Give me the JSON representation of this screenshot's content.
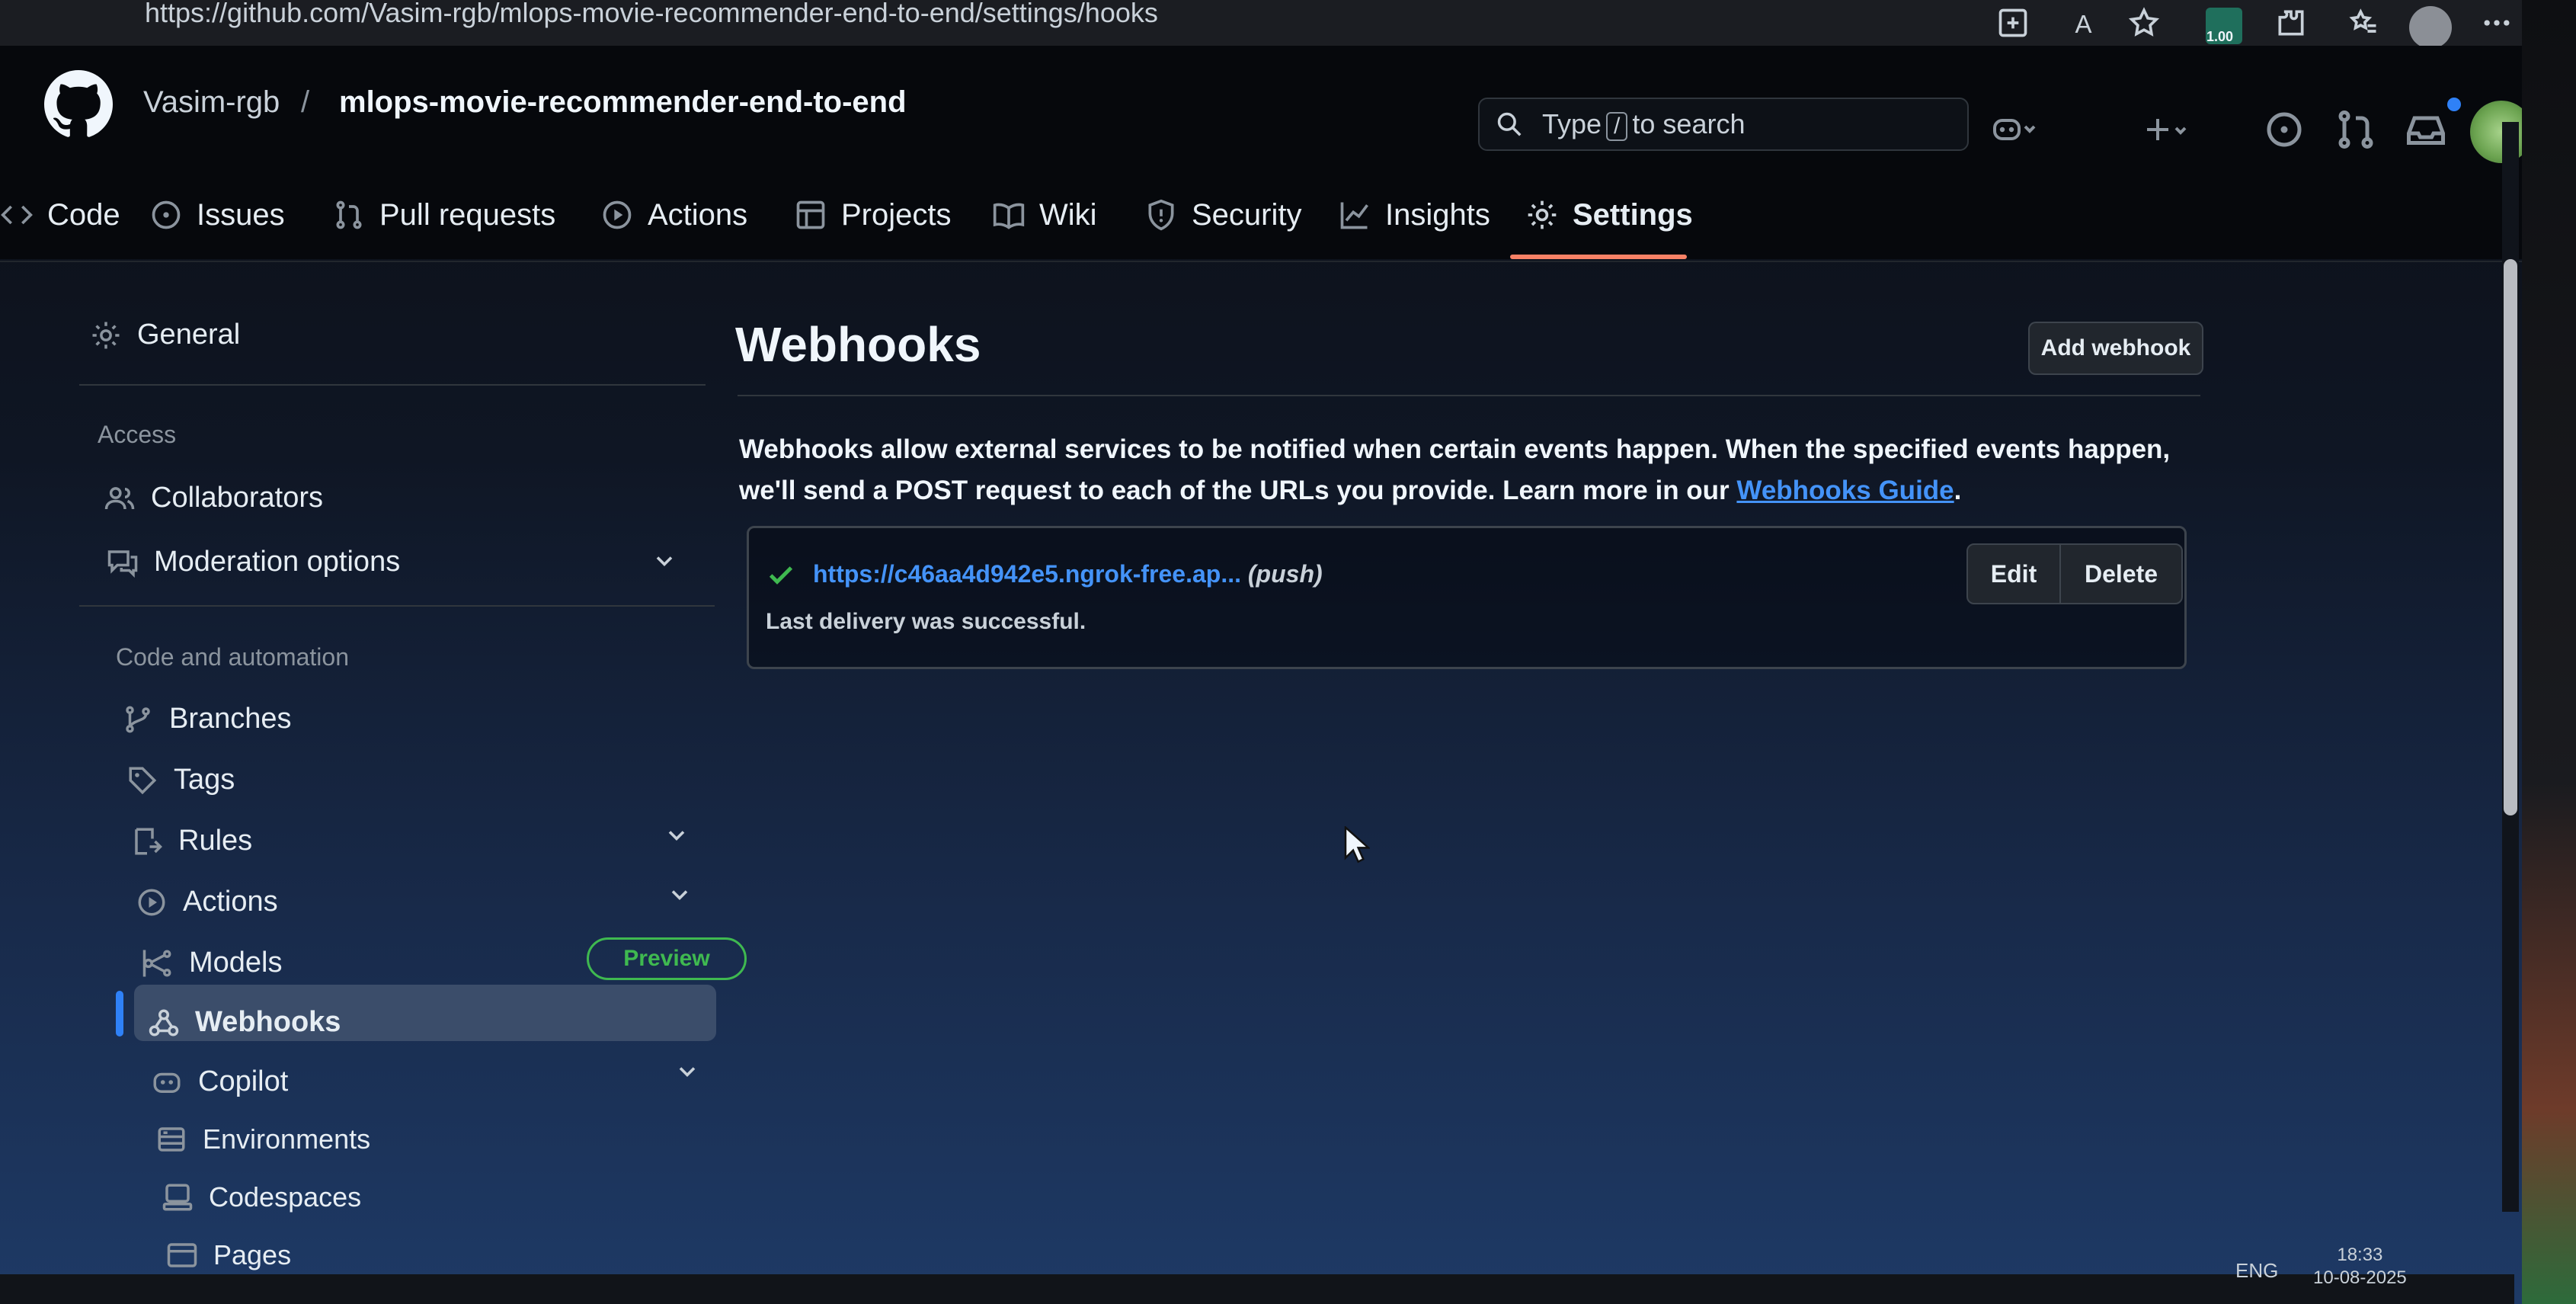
{
  "browser": {
    "url": "https://github.com/Vasim-rgb/mlops-movie-recommender-end-to-end/settings/hooks",
    "extension_badge": "1.00"
  },
  "header": {
    "owner": "Vasim-rgb",
    "separator": "/",
    "repo": "mlops-movie-recommender-end-to-end",
    "search_prefix": "Type",
    "search_key": "/",
    "search_suffix": "to search"
  },
  "tabs": [
    {
      "label": "Code",
      "icon": "code-icon"
    },
    {
      "label": "Issues",
      "icon": "issue-icon"
    },
    {
      "label": "Pull requests",
      "icon": "pull-request-icon"
    },
    {
      "label": "Actions",
      "icon": "play-icon"
    },
    {
      "label": "Projects",
      "icon": "table-icon"
    },
    {
      "label": "Wiki",
      "icon": "book-icon"
    },
    {
      "label": "Security",
      "icon": "shield-icon"
    },
    {
      "label": "Insights",
      "icon": "graph-icon"
    },
    {
      "label": "Settings",
      "icon": "gear-icon",
      "selected": true
    }
  ],
  "sidebar": {
    "general": "General",
    "access_heading": "Access",
    "access_items": [
      "Collaborators",
      "Moderation options"
    ],
    "code_heading": "Code and automation",
    "code_items": [
      "Branches",
      "Tags",
      "Rules",
      "Actions",
      "Models",
      "Webhooks",
      "Copilot",
      "Environments",
      "Codespaces",
      "Pages"
    ],
    "models_badge": "Preview",
    "selected": "Webhooks"
  },
  "main": {
    "title": "Webhooks",
    "add_button": "Add webhook",
    "description_start": "Webhooks allow external services to be notified when certain events happen. When the specified events happen, we'll send a POST request to each of the URLs you provide. Learn more in our ",
    "guide_link": "Webhooks Guide",
    "description_end": ".",
    "hook": {
      "url": "https://c46aa4d942e5.ngrok-free.ap...",
      "events": "(push)",
      "status": "Last delivery was successful.",
      "edit": "Edit",
      "delete": "Delete"
    }
  },
  "taskbar": {
    "lang": "ENG",
    "time": "18:33",
    "date": "10-08-2025"
  },
  "colors": {
    "accent_link": "#4493f8",
    "tab_underline": "#f78166",
    "success": "#3fb950",
    "selected_bg": "#3b4d6a"
  }
}
